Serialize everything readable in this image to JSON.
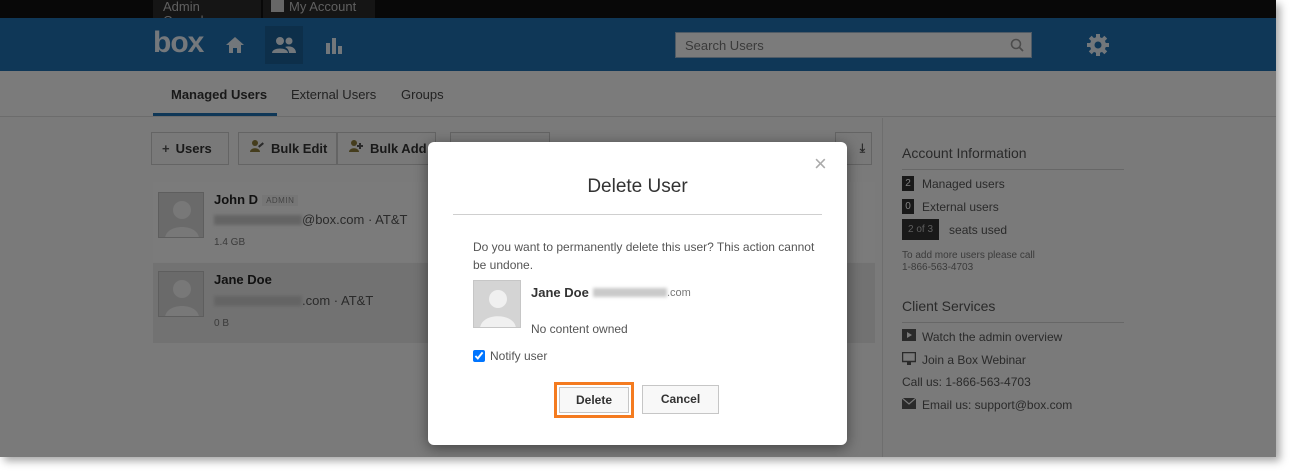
{
  "topbar": {
    "tabs": [
      "Admin Console",
      "My Account"
    ]
  },
  "header": {
    "logo": "box",
    "search": {
      "placeholder": "Search Users"
    }
  },
  "subnav": {
    "tabs": [
      "Managed Users",
      "External Users",
      "Groups"
    ],
    "active": "Managed Users"
  },
  "toolbar": {
    "add_users": "Users",
    "bulk_edit": "Bulk Edit",
    "bulk_add": "Bulk Add"
  },
  "users": [
    {
      "name": "John D",
      "badge": "ADMIN",
      "email_suffix": "@box.com",
      "company": "· AT&T",
      "size": "1.4 GB"
    },
    {
      "name": "Jane Doe",
      "email_suffix": ".com",
      "company": "· AT&T",
      "size": "0 B"
    }
  ],
  "sidebar": {
    "account_title": "Account Information",
    "managed_count": "2",
    "managed_label": "Managed users",
    "external_count": "0",
    "external_label": "External users",
    "seats_badge": "2 of 3",
    "seats_label": "seats used",
    "note_line1": "To add more users please call",
    "note_line2": "1-866-563-4703",
    "client_title": "Client Services",
    "watch": "Watch the admin overview",
    "webinar": "Join a Box Webinar",
    "call": "Call us: 1-866-563-4703",
    "email": "Email us: support@box.com"
  },
  "modal": {
    "close": "×",
    "title": "Delete User",
    "message": "Do you want to permanently delete this user? This action cannot be undone.",
    "user_name": "Jane Doe",
    "user_email_suffix": ".com",
    "no_content": "No content owned",
    "notify_label": "Notify user",
    "delete_label": "Delete",
    "cancel_label": "Cancel"
  },
  "colors": {
    "header_blue": "#1f6fae",
    "highlight_orange": "#f47b20"
  }
}
